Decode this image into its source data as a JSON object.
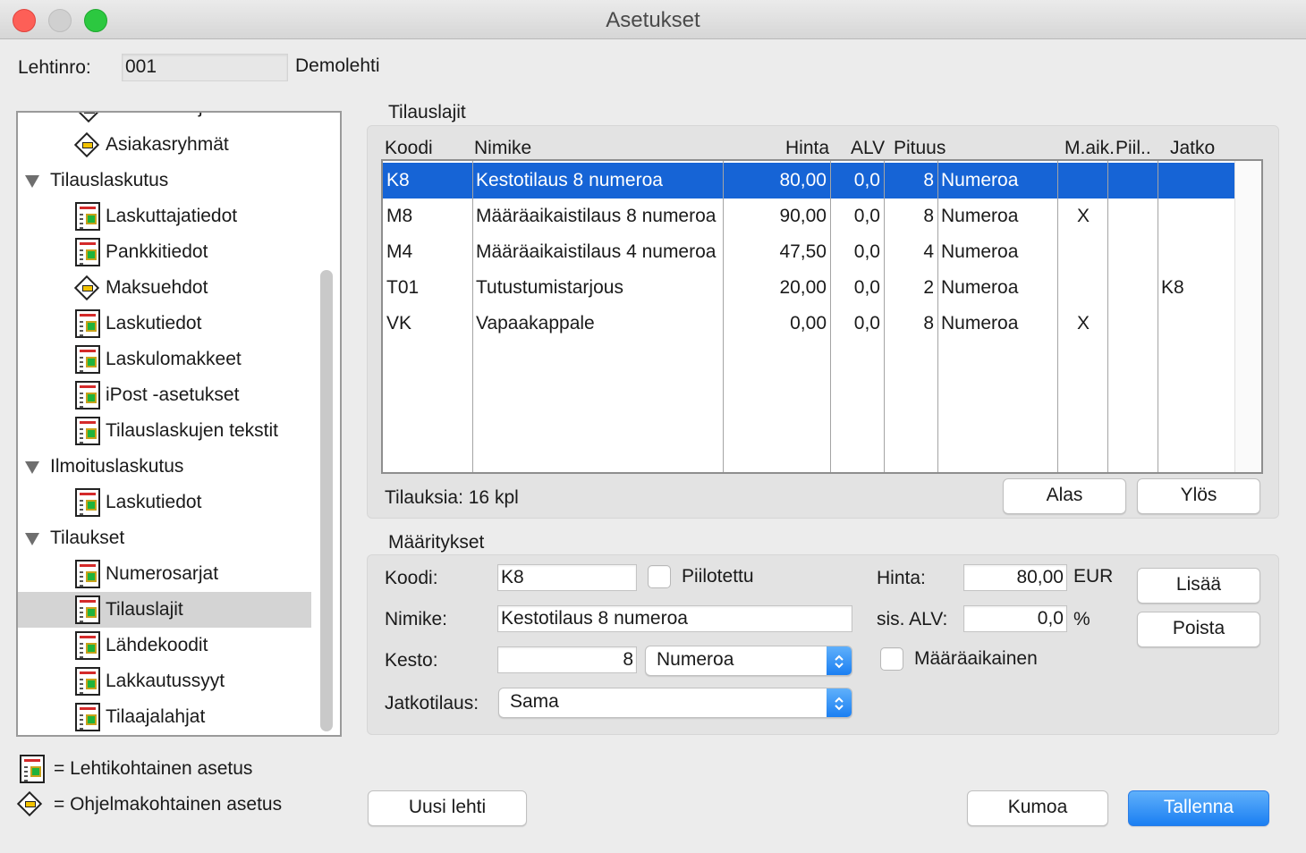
{
  "window": {
    "title": "Asetukset"
  },
  "header": {
    "lehtinro_label": "Lehtinro:",
    "lehtinro_value": "001",
    "paper_name": "Demolehti"
  },
  "tree": {
    "partial_top": "Numerosarjat",
    "rows": [
      {
        "label": "Asiakasryhmät",
        "icon": "diamond-icon"
      },
      {
        "label": "Tilauslaskutus",
        "group": true
      },
      {
        "label": "Laskuttajatiedot",
        "icon": "sheet-icon"
      },
      {
        "label": "Pankkitiedot",
        "icon": "sheet-icon"
      },
      {
        "label": "Maksuehdot",
        "icon": "diamond-icon"
      },
      {
        "label": "Laskutiedot",
        "icon": "sheet-icon"
      },
      {
        "label": "Laskulomakkeet",
        "icon": "sheet-icon"
      },
      {
        "label": "iPost -asetukset",
        "icon": "sheet-icon"
      },
      {
        "label": "Tilauslaskujen tekstit",
        "icon": "sheet-icon"
      },
      {
        "label": "Ilmoituslaskutus",
        "group": true
      },
      {
        "label": "Laskutiedot",
        "icon": "sheet-icon"
      },
      {
        "label": "Tilaukset",
        "group": true
      },
      {
        "label": "Numerosarjat",
        "icon": "sheet-icon"
      },
      {
        "label": "Tilauslajit",
        "icon": "sheet-icon",
        "selected": true
      },
      {
        "label": "Lähdekoodit",
        "icon": "sheet-icon"
      },
      {
        "label": "Lakkautussyyt",
        "icon": "sheet-icon"
      },
      {
        "label": "Tilaajalahjat",
        "icon": "sheet-icon"
      }
    ]
  },
  "legend": {
    "sheet_text": "= Lehtikohtainen asetus",
    "diamond_text": "= Ohjelmakohtainen asetus"
  },
  "tilauslajit": {
    "title": "Tilauslajit",
    "columns": {
      "koodi": "Koodi",
      "nimike": "Nimike",
      "hinta": "Hinta",
      "alv": "ALV",
      "pituus": "Pituus",
      "maik": "M.aik.",
      "piil": "Piil..",
      "jatko": "Jatko"
    },
    "rows": [
      {
        "koodi": "K8",
        "nimike": "Kestotilaus 8 numeroa",
        "hinta": "80,00",
        "alv": "0,0",
        "pituus": "8",
        "yksikko": "Numeroa",
        "maik": "",
        "piil": "",
        "jatko": ""
      },
      {
        "koodi": "M8",
        "nimike": "Määräaikaistilaus 8 numeroa",
        "hinta": "90,00",
        "alv": "0,0",
        "pituus": "8",
        "yksikko": "Numeroa",
        "maik": "X",
        "piil": "",
        "jatko": ""
      },
      {
        "koodi": "M4",
        "nimike": "Määräaikaistilaus 4 numeroa",
        "hinta": "47,50",
        "alv": "0,0",
        "pituus": "4",
        "yksikko": "Numeroa",
        "maik": "",
        "piil": "",
        "jatko": ""
      },
      {
        "koodi": "T01",
        "nimike": "Tutustumistarjous",
        "hinta": "20,00",
        "alv": "0,0",
        "pituus": "2",
        "yksikko": "Numeroa",
        "maik": "",
        "piil": "",
        "jatko": "K8"
      },
      {
        "koodi": "VK",
        "nimike": "Vapaakappale",
        "hinta": "0,00",
        "alv": "0,0",
        "pituus": "8",
        "yksikko": "Numeroa",
        "maik": "X",
        "piil": "",
        "jatko": ""
      }
    ],
    "count_text": "Tilauksia: 16 kpl",
    "alas_label": "Alas",
    "ylos_label": "Ylös"
  },
  "maaritykset": {
    "title": "Määritykset",
    "koodi_label": "Koodi:",
    "koodi_value": "K8",
    "piilotettu_label": "Piilotettu",
    "nimike_label": "Nimike:",
    "nimike_value": "Kestotilaus 8 numeroa",
    "kesto_label": "Kesto:",
    "kesto_value": "8",
    "kesto_unit": "Numeroa",
    "jatko_label": "Jatkotilaus:",
    "jatko_value": "Sama",
    "hinta_label": "Hinta:",
    "hinta_value": "80,00",
    "hinta_unit": "EUR",
    "alv_label": "sis. ALV:",
    "alv_value": "0,0",
    "alv_unit": "%",
    "maaraaikainen_label": "Määräaikainen",
    "lisaa_label": "Lisää",
    "poista_label": "Poista"
  },
  "footer": {
    "uusi_label": "Uusi lehti",
    "kumoa_label": "Kumoa",
    "tallenna_label": "Tallenna"
  },
  "colors": {
    "selection": "#1664d6",
    "primary": "#1b7ff2"
  }
}
